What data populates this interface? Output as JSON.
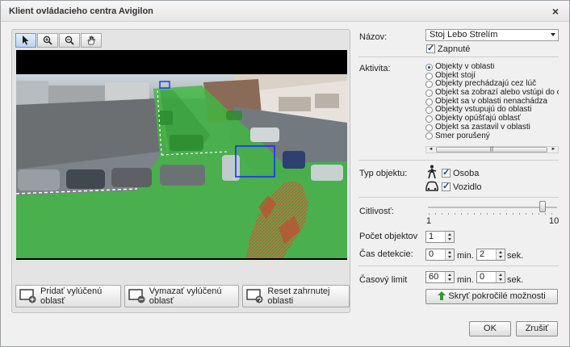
{
  "window": {
    "title": "Klient ovládacieho centra Avigilon",
    "close": "×"
  },
  "toolbar": {
    "tools": [
      "pointer-icon",
      "zoom-in-icon",
      "zoom-out-icon",
      "pan-hand-icon"
    ]
  },
  "actions": {
    "add_exclusion": "Pridať vylúčenú oblasť",
    "delete_exclusion": "Vymazať vylúčenú oblasť",
    "reset_area": "Reset zahrnutej oblasti"
  },
  "form": {
    "name_label": "Názov:",
    "name_value": "Stoj Lebo Strelím",
    "enabled_label": "Zapnuté",
    "activity_label": "Aktivita:",
    "activities": [
      "Objekty v oblasti",
      "Objekt stojí",
      "Objekty prechádzajú cez lúč",
      "Objekt sa zobrazí alebo vstúpi do oblas",
      "Objekt sa v oblasti nenachádza",
      "Objekty vstupujú do oblasti",
      "Objekty opúšťajú oblasť",
      "Objekt sa zastavil v oblasti",
      "Smer porušený"
    ],
    "activity_selected": 0,
    "object_type_label": "Typ objektu:",
    "person_label": "Osoba",
    "vehicle_label": "Vozidlo",
    "sensitivity_label": "Citlivosť:",
    "sensitivity_min": "1",
    "sensitivity_max": "10",
    "sensitivity_value": 9,
    "object_count_label": "Počet objektov",
    "object_count_value": "1",
    "detection_time_label": "Čas detekcie:",
    "detection_min_value": "0",
    "detection_sec_value": "2",
    "min_unit": "min.",
    "sec_unit": "sek.",
    "time_limit_label": "Časový limit",
    "time_limit_min_value": "60",
    "time_limit_sec_value": "0",
    "hide_advanced": "Skryť pokročilé možnosti"
  },
  "footer": {
    "ok": "OK",
    "cancel": "Zrušiť"
  },
  "colors": {
    "mask": "#3fb83f",
    "selection": "#1c2cff",
    "heat": "#e23b2e"
  }
}
